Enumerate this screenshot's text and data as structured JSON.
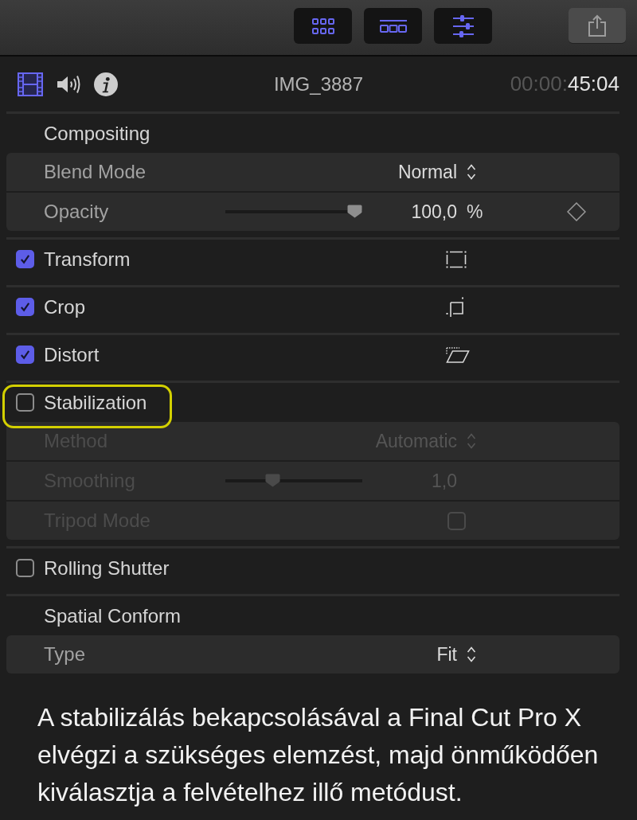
{
  "toolbar": {
    "view_buttons": [
      {
        "on": true
      },
      {
        "on": true
      },
      {
        "on": true
      }
    ]
  },
  "inspector_tabs": [
    {
      "selected": true
    },
    {
      "selected": false
    },
    {
      "selected": false
    }
  ],
  "clip_title": "IMG_3887",
  "timecode": {
    "leading": "00:00:",
    "main": "45:04"
  },
  "sections": [
    {
      "kind": "heading",
      "title": "Compositing",
      "rows": [
        {
          "kind": "popup",
          "label": "Blend Mode",
          "value": "Normal"
        },
        {
          "kind": "slider",
          "label": "Opacity",
          "level": 1,
          "value": "100,0",
          "unit": "%",
          "keyframe": true
        }
      ]
    },
    {
      "kind": "check",
      "title": "Transform",
      "checked": true
    },
    {
      "kind": "check",
      "title": "Crop",
      "checked": true
    },
    {
      "kind": "check",
      "title": "Distort",
      "checked": true
    },
    {
      "kind": "check",
      "title": "Stabilization",
      "checked": false,
      "highlighted": true,
      "rows": [
        {
          "kind": "popup",
          "label": "Method",
          "value": "Automatic"
        },
        {
          "kind": "slider",
          "label": "Smoothing",
          "level": 0.33,
          "value": "1,0"
        },
        {
          "kind": "checkbox",
          "label": "Tripod Mode",
          "checked": false
        }
      ]
    },
    {
      "kind": "check",
      "title": "Rolling Shutter",
      "checked": false
    },
    {
      "kind": "heading",
      "title": "Spatial Conform",
      "rows": [
        {
          "kind": "popup",
          "label": "Type",
          "value": "Fit"
        }
      ]
    }
  ],
  "caption": "A stabilizálás bekapcsolásával a Final Cut Pro X elvégzi a szükséges elemzést, majd önműködően kiválasztja a felvételhez illő metódust."
}
